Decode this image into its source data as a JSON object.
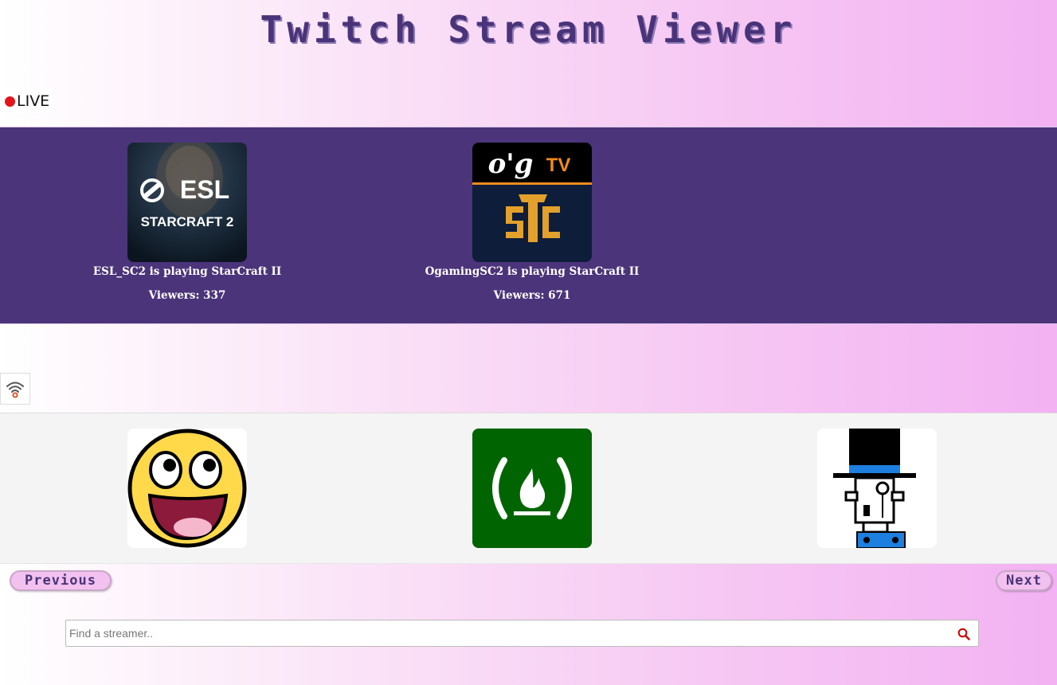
{
  "app": {
    "title": "Twitch Stream Viewer"
  },
  "live_section": {
    "label": "LIVE",
    "streams": [
      {
        "channel": "ESL_SC2",
        "title": "ESL_SC2 is playing StarCraft II",
        "viewers_label": "Viewers: 337",
        "logo_text_1": "ESL",
        "logo_text_2": "STARCRAFT 2"
      },
      {
        "channel": "OgamingSC2",
        "title": "OgamingSC2 is playing StarCraft II",
        "viewers_label": "Viewers: 671",
        "logo_text_1": "o'g",
        "logo_text_2": "TV"
      }
    ]
  },
  "offline_section": {
    "icon": "wifi-signal-icon",
    "channels": [
      {
        "logo": "awesome-smiley-logo"
      },
      {
        "logo": "freecodecamp-logo"
      },
      {
        "logo": "robot-top-hat-logo"
      }
    ]
  },
  "pagination": {
    "previous_label": "Previous",
    "next_label": "Next"
  },
  "search": {
    "placeholder": "Find a streamer..",
    "value": ""
  },
  "colors": {
    "title": "#4a3479",
    "live_panel": "#4b347a",
    "live_dot": "#e3151b",
    "fcc_green": "#006400",
    "search_icon": "#cc0000"
  }
}
